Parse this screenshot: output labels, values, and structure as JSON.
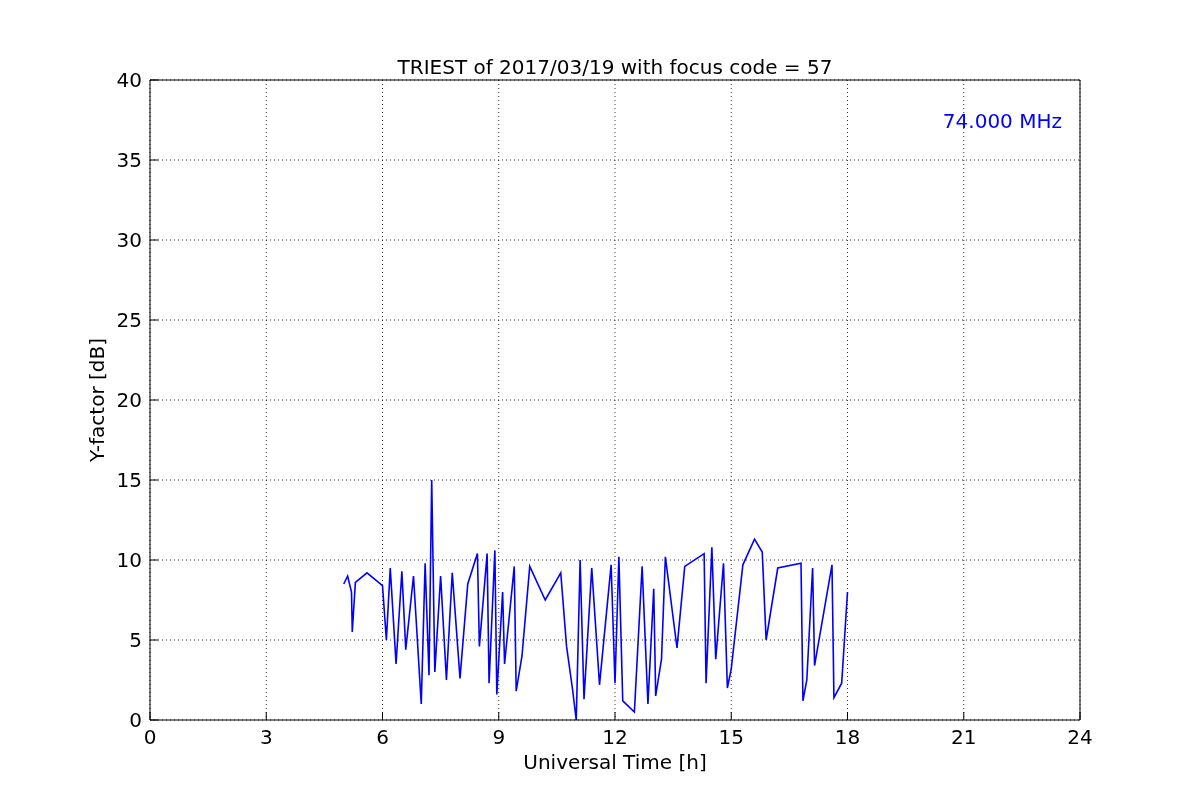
{
  "chart_data": {
    "type": "line",
    "title": "TRIEST of 2017/03/19 with focus code = 57",
    "xlabel": "Universal Time [h]",
    "ylabel": "Y-factor [dB]",
    "xlim": [
      0,
      24
    ],
    "ylim": [
      0,
      40
    ],
    "xticks": [
      0,
      3,
      6,
      9,
      12,
      15,
      18,
      21,
      24
    ],
    "yticks": [
      0,
      5,
      10,
      15,
      20,
      25,
      30,
      35,
      40
    ],
    "annotations": [
      "74.000 MHz"
    ],
    "grid": true,
    "x": [
      5.0,
      5.1,
      5.2,
      5.22,
      5.3,
      5.6,
      6.0,
      6.1,
      6.2,
      6.35,
      6.5,
      6.6,
      6.8,
      7.0,
      7.1,
      7.2,
      7.27,
      7.35,
      7.5,
      7.65,
      7.8,
      8.0,
      8.2,
      8.45,
      8.5,
      8.7,
      8.75,
      8.9,
      8.95,
      9.1,
      9.15,
      9.4,
      9.45,
      9.6,
      9.8,
      10.2,
      10.6,
      10.75,
      10.9,
      11.0,
      11.1,
      11.2,
      11.4,
      11.6,
      11.9,
      12.0,
      12.1,
      12.2,
      12.5,
      12.7,
      12.85,
      13.0,
      13.05,
      13.2,
      13.3,
      13.6,
      13.8,
      14.3,
      14.35,
      14.5,
      14.6,
      14.8,
      14.9,
      15.0,
      15.3,
      15.6,
      15.8,
      15.9,
      16.2,
      16.8,
      16.85,
      16.95,
      17.1,
      17.15,
      17.6,
      17.65,
      17.85,
      18.0
    ],
    "series": [
      {
        "color": "#0000ff",
        "values": [
          8.5,
          9.0,
          8.0,
          5.5,
          8.6,
          9.2,
          8.4,
          5.0,
          9.5,
          3.5,
          9.3,
          4.4,
          9.0,
          1.0,
          9.8,
          2.8,
          15.0,
          3.0,
          9.0,
          2.5,
          9.2,
          2.6,
          8.5,
          10.4,
          4.6,
          10.4,
          2.3,
          10.6,
          1.6,
          8.0,
          3.5,
          9.6,
          1.8,
          4.0,
          9.6,
          7.5,
          9.2,
          4.6,
          2.0,
          0.0,
          10.0,
          1.3,
          9.5,
          2.2,
          9.7,
          2.3,
          10.2,
          1.2,
          0.5,
          9.6,
          1.0,
          8.2,
          1.5,
          3.8,
          10.2,
          4.5,
          9.6,
          10.4,
          2.3,
          10.8,
          3.8,
          9.8,
          2.0,
          3.2,
          9.7,
          11.3,
          10.5,
          5.0,
          9.5,
          9.8,
          1.2,
          2.5,
          9.5,
          3.4,
          9.7,
          1.4,
          2.3,
          8.0
        ]
      }
    ]
  }
}
